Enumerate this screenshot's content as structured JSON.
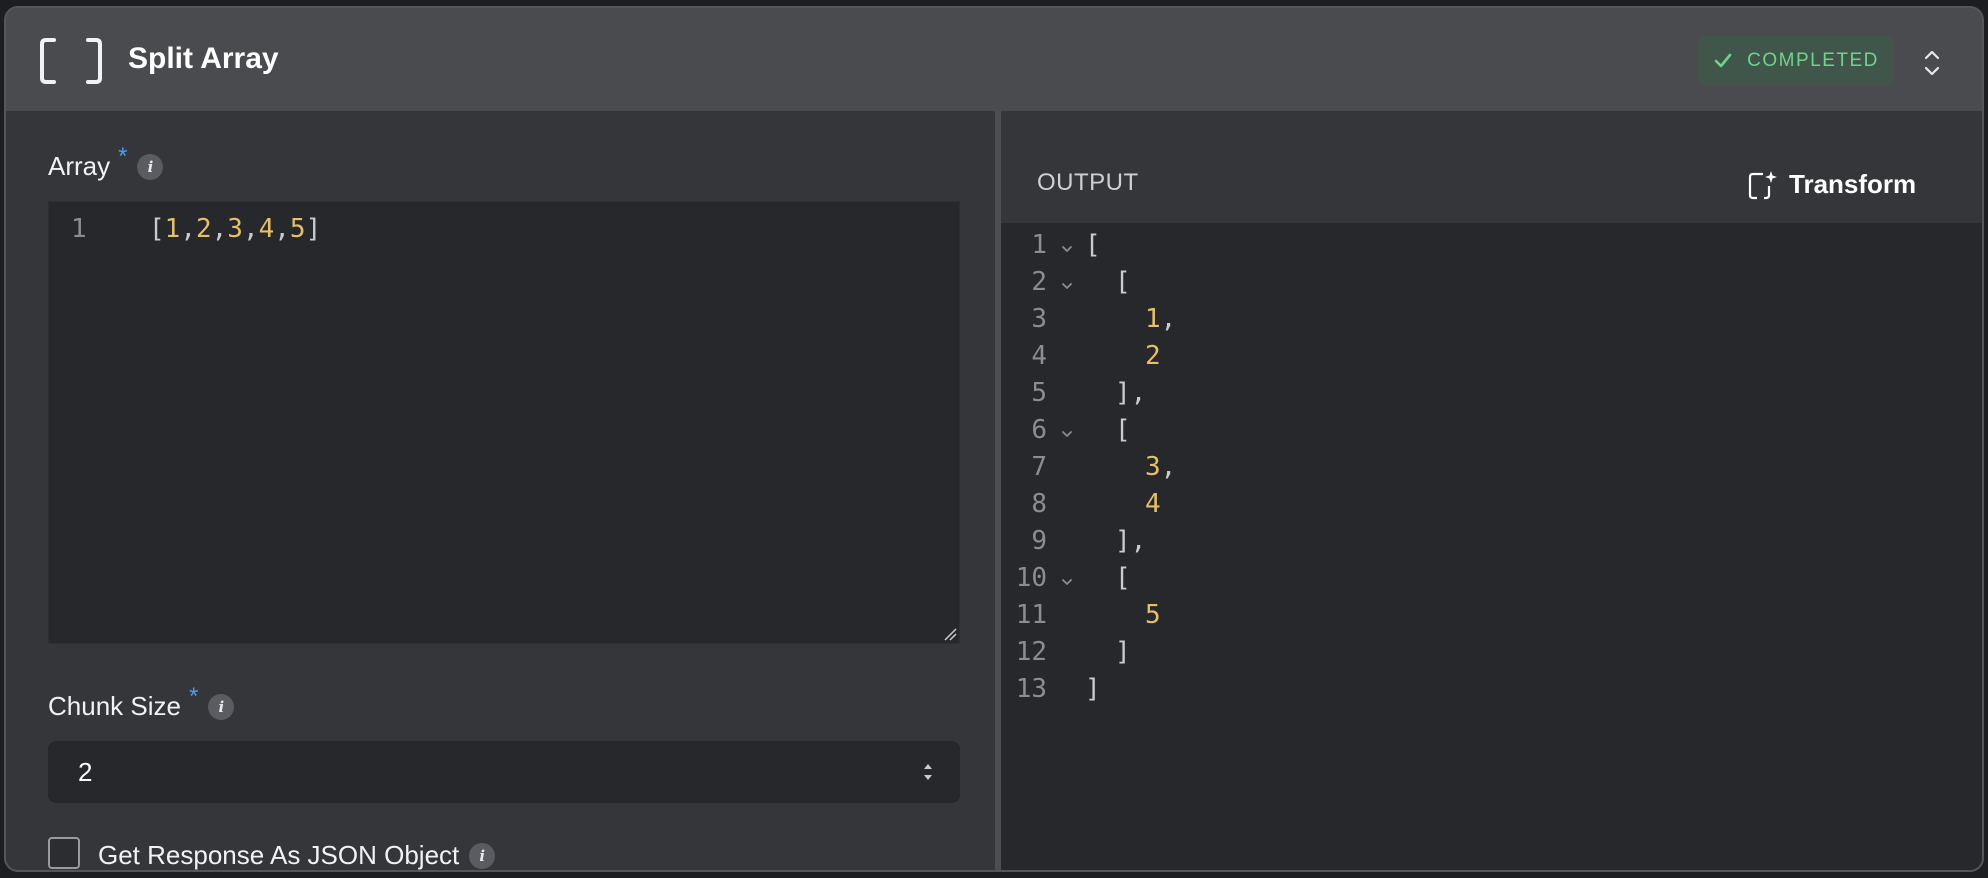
{
  "header": {
    "title": "Split Array",
    "status": "COMPLETED",
    "colors": {
      "status_text": "#6fd38a",
      "status_bg": "#40564a"
    }
  },
  "array_field": {
    "label": "Array",
    "required_mark": "*",
    "info": "i",
    "line_number": "1",
    "code_tokens": [
      "[",
      "1",
      ",",
      "2",
      ",",
      "3",
      ",",
      "4",
      ",",
      "5",
      "]"
    ]
  },
  "chunk_field": {
    "label": "Chunk Size",
    "required_mark": "*",
    "info": "i",
    "value": "2"
  },
  "json_option": {
    "label": "Get Response As JSON Object",
    "info": "i",
    "checked": false
  },
  "output": {
    "label": "OUTPUT",
    "transform_label": "Transform",
    "lines": [
      {
        "n": "1",
        "fold": true,
        "text": "[",
        "kind": "punct"
      },
      {
        "n": "2",
        "fold": true,
        "text": "[",
        "kind": "punct"
      },
      {
        "n": "3",
        "fold": false,
        "text": "1",
        "suffix": ",",
        "kind": "num"
      },
      {
        "n": "4",
        "fold": false,
        "text": "2",
        "suffix": "",
        "kind": "num"
      },
      {
        "n": "5",
        "fold": false,
        "text": "],",
        "kind": "punct"
      },
      {
        "n": "6",
        "fold": true,
        "text": "[",
        "kind": "punct"
      },
      {
        "n": "7",
        "fold": false,
        "text": "3",
        "suffix": ",",
        "kind": "num"
      },
      {
        "n": "8",
        "fold": false,
        "text": "4",
        "suffix": "",
        "kind": "num"
      },
      {
        "n": "9",
        "fold": false,
        "text": "],",
        "kind": "punct"
      },
      {
        "n": "10",
        "fold": true,
        "text": "[",
        "kind": "punct"
      },
      {
        "n": "11",
        "fold": false,
        "text": "5",
        "suffix": "",
        "kind": "num"
      },
      {
        "n": "12",
        "fold": false,
        "text": "]",
        "kind": "punct"
      },
      {
        "n": "13",
        "fold": false,
        "text": "]",
        "kind": "punct"
      }
    ]
  }
}
